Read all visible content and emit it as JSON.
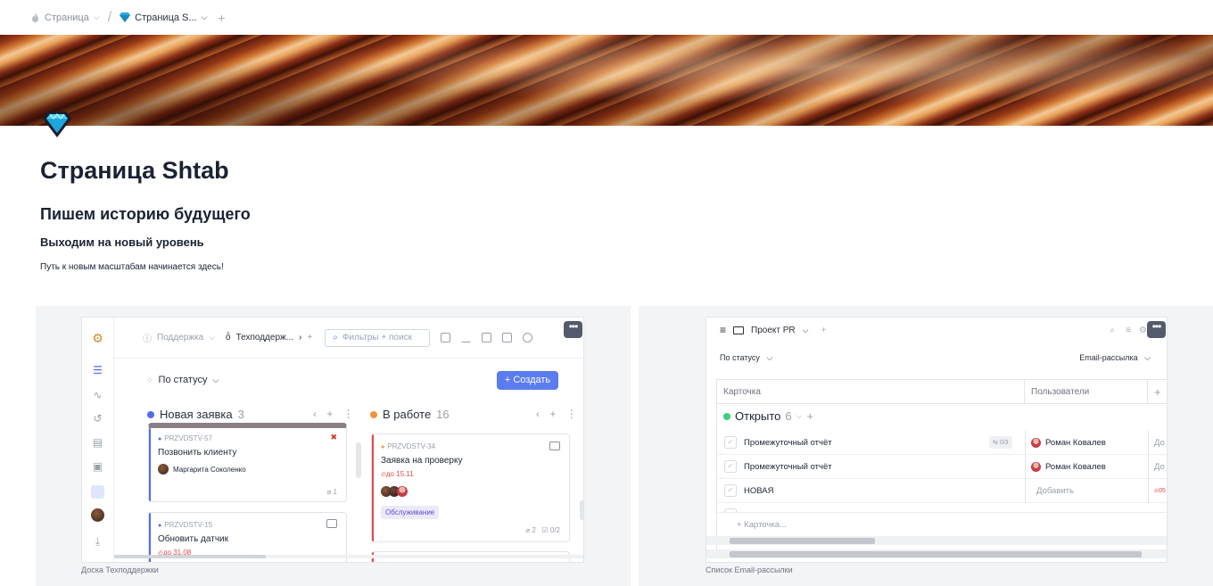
{
  "breadcrumb": {
    "parent_label": "Страница",
    "current_label": "Страница S...",
    "add_symbol": "+"
  },
  "page": {
    "title": "Страница Shtab",
    "heading2": "Пишем историю будущего",
    "heading3": "Выходим на новый уровень",
    "paragraph": "Путь к новым масштабам начинается здесь!"
  },
  "embeds": {
    "board": {
      "caption": "Доска Техподдержки",
      "more_label": "•••",
      "breadcrumb_parent": "Поддержка",
      "breadcrumb_current": "Техподдерж...",
      "search_placeholder": "Фильтры + поиск",
      "group_by": "По статусу",
      "create_label": "+ Создать",
      "columns": [
        {
          "name": "Новая заявка",
          "count": "3",
          "color": "#4f6ef2",
          "cards": [
            {
              "id": "PRZVDSTV-57",
              "name": "Позвонить клиенту",
              "assignee": "Маргарита Соколенко",
              "attachments": "1"
            },
            {
              "id": "PRZVDSTV-15",
              "name": "Обновить датчик",
              "due": "до 31.08"
            }
          ]
        },
        {
          "name": "В работе",
          "count": "16",
          "color": "#f0953c",
          "cards": [
            {
              "id": "PRZVDSTV-34",
              "name": "Заявка на проверку",
              "due": "до 15.11",
              "tag": "Обслуживание",
              "attachments": "2",
              "checklist": "0/2"
            }
          ]
        }
      ]
    },
    "list": {
      "caption": "Список Email-рассылки",
      "more_label": "•••",
      "project": "Проект PR",
      "group_by": "По статусу",
      "view_field": "Email-рассылка",
      "columns": [
        "Карточка",
        "Пользователи",
        "+"
      ],
      "group": {
        "name": "Открыто",
        "count": "6",
        "color": "#3ccf7a"
      },
      "rows": [
        {
          "name": "Промежуточный отчёт",
          "subtasks": "0/3",
          "user": "Роман Ковалев",
          "extra": "До"
        },
        {
          "name": "Промежуточный отчёт",
          "subtasks": "",
          "user": "Роман Ковалев",
          "extra": "До"
        },
        {
          "name": "НОВАЯ",
          "subtasks": "",
          "user": "Добавить",
          "extra": "05"
        }
      ],
      "add_card": "+ Карточка..."
    }
  }
}
